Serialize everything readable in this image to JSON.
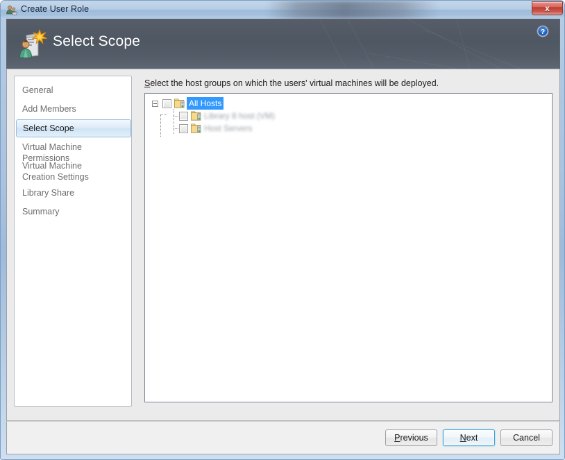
{
  "window": {
    "titlebar": {
      "title": "Create User Role",
      "icon": "user-role-icon",
      "close_label": "x"
    },
    "header": {
      "title": "Select Scope",
      "icon": "server-new-icon",
      "help_icon": "help-question-icon"
    }
  },
  "sidebar": {
    "items": [
      {
        "label": "General",
        "active": false
      },
      {
        "label": "Add Members",
        "active": false
      },
      {
        "label": "Select Scope",
        "active": true
      },
      {
        "label": "Virtual Machine Permissions",
        "active": false
      },
      {
        "label": "Virtual Machine Creation Settings",
        "active": false
      },
      {
        "label": "Library Share",
        "active": false
      },
      {
        "label": "Summary",
        "active": false
      }
    ]
  },
  "content": {
    "instruction_accesskey": "S",
    "instruction_rest": "elect the host groups on which the users' virtual machines will be deployed.",
    "tree": {
      "nodes": [
        {
          "label": "All Hosts",
          "depth": 0,
          "selected": true,
          "blurred": false,
          "checked": false,
          "expanded": true,
          "icon": "host-group-folder-icon"
        },
        {
          "label": "Library 8 host (VM)",
          "depth": 1,
          "selected": false,
          "blurred": true,
          "checked": false,
          "expanded": false,
          "icon": "host-group-folder-icon"
        },
        {
          "label": "Host Servers",
          "depth": 1,
          "selected": false,
          "blurred": true,
          "checked": false,
          "expanded": false,
          "icon": "host-group-folder-icon"
        }
      ]
    }
  },
  "footer": {
    "buttons": [
      {
        "name": "previous-button",
        "pre": "P",
        "post": "revious",
        "default": false
      },
      {
        "name": "next-button",
        "pre": "N",
        "post": "ext",
        "default": true
      },
      {
        "name": "cancel-button",
        "pre": "",
        "post": "Cancel",
        "default": false
      }
    ]
  },
  "colors": {
    "header_bg": "#4f5763",
    "selection_blue": "#3399ff",
    "accent_focus": "#2f9fd4",
    "close_red": "#bf3d32"
  }
}
